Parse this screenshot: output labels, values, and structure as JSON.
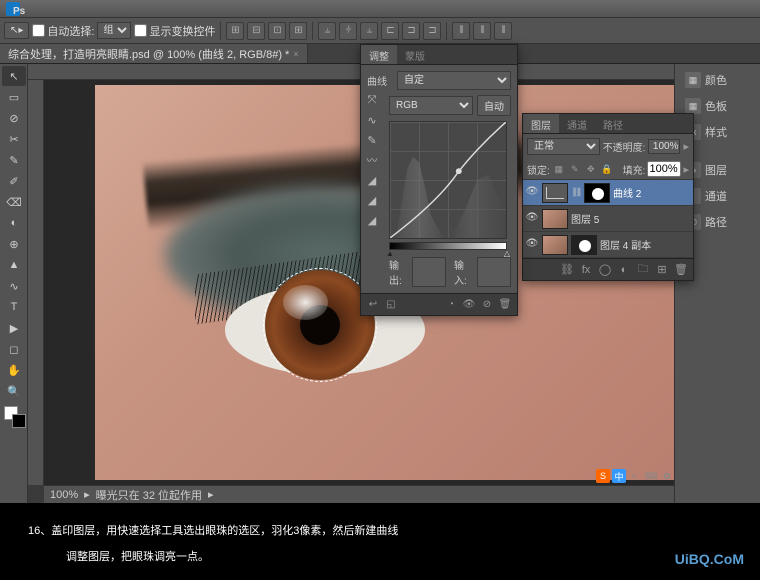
{
  "ps_badge": "Ps",
  "options": {
    "auto_select": "自动选择:",
    "group": "组",
    "show_transform": "显示变换控件"
  },
  "tab_title": "综合处理，打造明亮眼睛.psd @ 100% (曲线 2, RGB/8#) *",
  "tools": [
    "↖",
    "▭",
    "⊘",
    "✂",
    "✎",
    "✐",
    "⌫",
    "◐",
    "⊕",
    "▲",
    "∿",
    "T",
    "▶",
    "◻",
    "✋",
    "🔍"
  ],
  "status": {
    "zoom": "100%",
    "exposure": "曝光只在 32 位起作用"
  },
  "adjust": {
    "tab1": "调整",
    "tab2": "蒙版",
    "preset_label": "曲线",
    "preset": "自定",
    "channel": "RGB",
    "auto": "自动",
    "output_label": "输出:",
    "input_label": "输入:"
  },
  "layers": {
    "tab1": "图层",
    "tab2": "通道",
    "tab3": "路径",
    "blend": "正常",
    "opacity_label": "不透明度:",
    "opacity": "100%",
    "lock_label": "锁定:",
    "fill_label": "填充:",
    "fill": "100%",
    "items": [
      {
        "name": "曲线 2",
        "sel": true,
        "type": "curve"
      },
      {
        "name": "图层 5",
        "type": "eye"
      },
      {
        "name": "图层 4 副本",
        "type": "eye-mask"
      }
    ]
  },
  "dock": {
    "color": "颜色",
    "swatch": "色板",
    "style": "样式",
    "layer": "图层",
    "channel": "通道",
    "path": "路径"
  },
  "tutorial": {
    "step": "16、",
    "text1": "盖印图层，用快速选择工具选出眼珠的选区，羽化3像素，然后新建曲线",
    "text2": "调整图层，把眼珠调亮一点。"
  },
  "watermark": "UiBQ.CoM"
}
